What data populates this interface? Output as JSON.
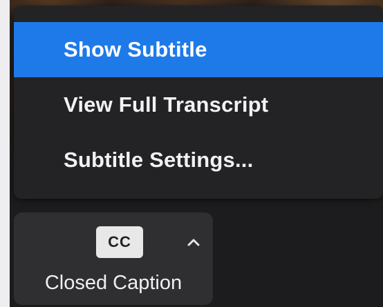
{
  "menu": {
    "items": [
      {
        "label": "Show Subtitle",
        "selected": true
      },
      {
        "label": "View Full Transcript",
        "selected": false
      },
      {
        "label": "Subtitle Settings...",
        "selected": false
      }
    ]
  },
  "caption_button": {
    "badge": "CC",
    "label": "Closed Caption",
    "chevron_icon": "chevron-up-icon"
  },
  "colors": {
    "selected_accent": "#1f7ae9",
    "menu_background": "#232325",
    "button_background": "#2f2f31"
  }
}
